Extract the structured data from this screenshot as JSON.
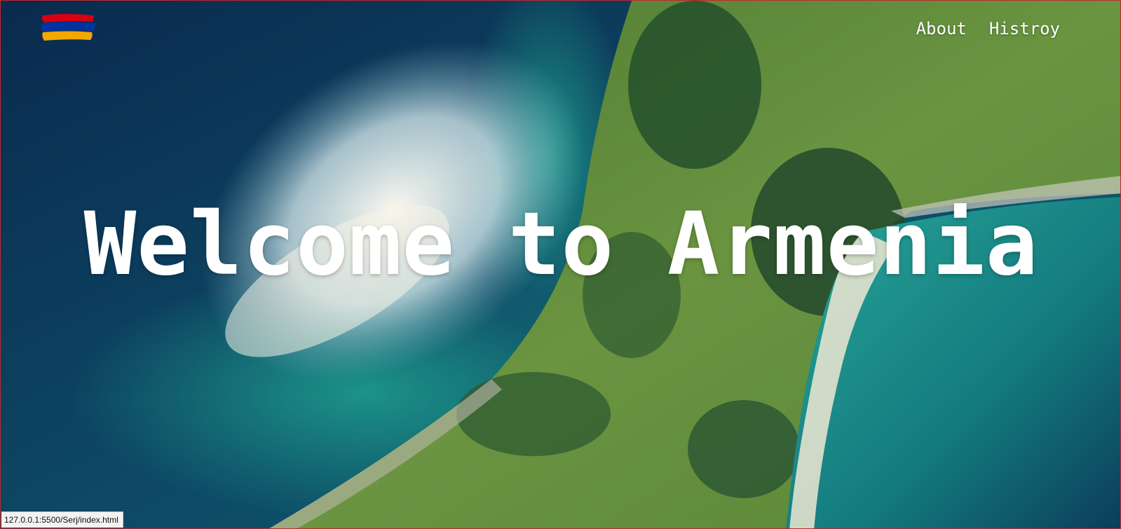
{
  "colors": {
    "flag_red": "#d90012",
    "flag_blue": "#0033a0",
    "flag_orange": "#f2a800",
    "text": "#ffffff",
    "deep_water": "#0b2a4a",
    "teal_water": "#1f8f8a",
    "foam": "#f4f1e8",
    "land_green": "#5f8a3a",
    "forest": "#24502c",
    "sand": "#efe7d2",
    "frame_border": "#c2272d"
  },
  "header": {
    "logo_icon": "armenian-flag-icon",
    "nav": [
      {
        "label": "About"
      },
      {
        "label": "Histroy"
      }
    ]
  },
  "hero": {
    "title": "Welcome to Armenia",
    "background": "aerial-coastline-photo"
  },
  "status_bar": {
    "url": "127.0.0.1:5500/Serj/index.html"
  }
}
